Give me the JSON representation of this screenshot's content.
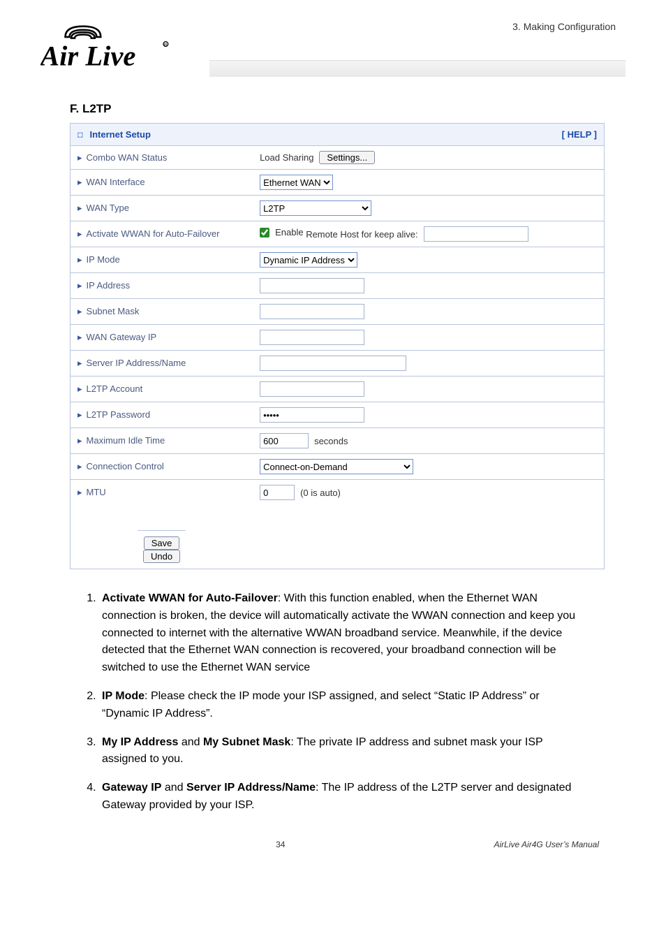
{
  "header": {
    "section_label": "3. Making Configuration",
    "logo_alt": "Air Live"
  },
  "subheading": "F. L2TP",
  "panel": {
    "title": "Internet Setup",
    "help": "[ HELP ]",
    "rows": {
      "combo_wan_status": {
        "label": "Combo WAN Status",
        "prefix_text": "Load Sharing",
        "button": "Settings..."
      },
      "wan_interface": {
        "label": "WAN Interface",
        "value": "Ethernet WAN"
      },
      "wan_type": {
        "label": "WAN Type",
        "value": "L2TP"
      },
      "activate_wwan": {
        "label": "Activate WWAN for Auto-Failover",
        "checkbox_label": "Enable",
        "sub_label": "Remote Host for keep alive:",
        "sub_value": ""
      },
      "ip_mode": {
        "label": "IP Mode",
        "value": "Dynamic IP Address"
      },
      "ip_address": {
        "label": "IP Address",
        "value": ""
      },
      "subnet_mask": {
        "label": "Subnet Mask",
        "value": ""
      },
      "wan_gateway_ip": {
        "label": "WAN Gateway IP",
        "value": ""
      },
      "server_ip": {
        "label": "Server IP Address/Name",
        "value": ""
      },
      "l2tp_account": {
        "label": "L2TP Account",
        "value": ""
      },
      "l2tp_password": {
        "label": "L2TP Password",
        "value": "•••••"
      },
      "max_idle": {
        "label": "Maximum Idle Time",
        "value": "600",
        "unit": "seconds"
      },
      "conn_control": {
        "label": "Connection Control",
        "value": "Connect-on-Demand"
      },
      "mtu": {
        "label": "MTU",
        "value": "0",
        "unit": "(0 is auto)"
      }
    },
    "buttons": {
      "save": "Save",
      "undo": "Undo"
    }
  },
  "instructions": {
    "i1_bold": "Activate WWAN for Auto-Failover",
    "i1_rest": ": With this function enabled, when the Ethernet WAN connection is broken, the device will automatically activate the WWAN connection and keep you connected to internet with the alternative WWAN broadband service. Meanwhile, if the device detected that the Ethernet WAN connection is recovered, your broadband connection will be switched to use the Ethernet WAN service",
    "i2_bold": "IP Mode",
    "i2_rest": ": Please check the IP mode your ISP assigned, and select “Static IP Address” or “Dynamic IP Address”.",
    "i3_bold_a": "My IP Address",
    "i3_mid": " and ",
    "i3_bold_b": "My Subnet Mask",
    "i3_rest": ": The private IP address and subnet mask your ISP assigned to you.",
    "i4_bold_a": "Gateway IP",
    "i4_mid": " and ",
    "i4_bold_b": "Server IP Address/Name",
    "i4_rest": ": The IP address of the L2TP server and designated Gateway provided by your ISP."
  },
  "footer": {
    "page": "34",
    "manual": "AirLive Air4G User’s Manual"
  }
}
